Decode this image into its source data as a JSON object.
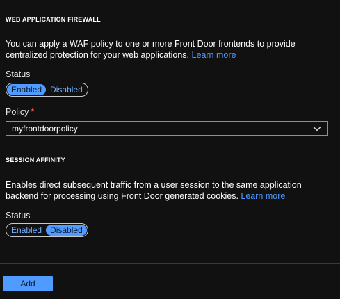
{
  "waf": {
    "heading": "WEB APPLICATION FIREWALL",
    "description": "You can apply a WAF policy to one or more Front Door frontends to provide centralized protection for your web applications.",
    "learn_more": "Learn more",
    "status_label": "Status",
    "status_options": [
      "Enabled",
      "Disabled"
    ],
    "status_selected": "Enabled",
    "policy_label": "Policy",
    "policy_required_marker": "*",
    "policy_value": "myfrontdoorpolicy"
  },
  "session_affinity": {
    "heading": "SESSION AFFINITY",
    "description": "Enables direct subsequent traffic from a user session to the same application backend for processing using Front Door generated cookies.",
    "learn_more": "Learn more",
    "status_label": "Status",
    "status_options": [
      "Enabled",
      "Disabled"
    ],
    "status_selected": "Disabled"
  },
  "footer": {
    "add_label": "Add"
  },
  "colors": {
    "accent": "#4f9bff",
    "background": "#111111",
    "required": "#ff6b6b"
  },
  "icons": {
    "policy_dropdown": "chevron-down-icon"
  }
}
